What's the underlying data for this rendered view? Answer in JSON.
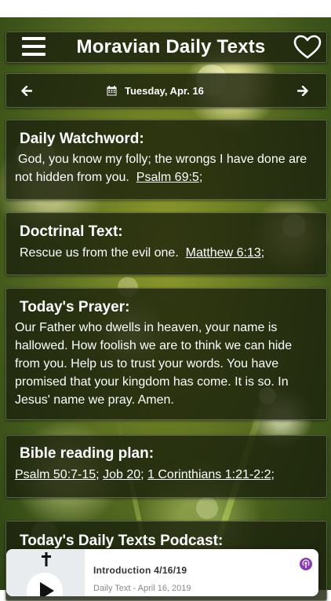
{
  "app": {
    "title": "Moravian Daily Texts"
  },
  "date_bar": {
    "date": "Tuesday, Apr. 16"
  },
  "watchword": {
    "heading": "Daily Watchword:",
    "text": "God, you know my folly; the wrongs I have done are not hidden from you.",
    "reference": "Psalm 69:5",
    "separator": ";"
  },
  "doctrinal": {
    "heading": "Doctrinal Text:",
    "text": "Rescue us from the evil one.",
    "reference": "Matthew 6:13",
    "separator": ";"
  },
  "prayer": {
    "heading": "Today's Prayer:",
    "text": "Our Father who dwells in heaven, your name is hallowed. How foolish we are to think we can hide from you. Help us to trust your words. You have promised that your kingdom has come. It is so. In Jesus' name we pray. Amen."
  },
  "reading_plan": {
    "heading": "Bible reading plan:",
    "references": [
      "Psalm 50:7-15",
      "Job 20",
      "1 Corinthians 1:21-2:2"
    ]
  },
  "podcast": {
    "heading": "Today's Daily Texts Podcast:",
    "episode_title": "Introduction 4/16/19",
    "episode_subtitle": "Daily Text - April 16, 2019"
  },
  "icons": {
    "menu": "hamburger-menu",
    "favorite": "heart-outline",
    "previous": "arrow-left",
    "next": "arrow-right",
    "calendar": "calendar",
    "play": "play",
    "cross": "cross",
    "podcast": "podcast-broadcast"
  },
  "colors": {
    "panel": "#1c220c",
    "text": "#ffffff",
    "podcast_accent": "#8a3ab9"
  }
}
